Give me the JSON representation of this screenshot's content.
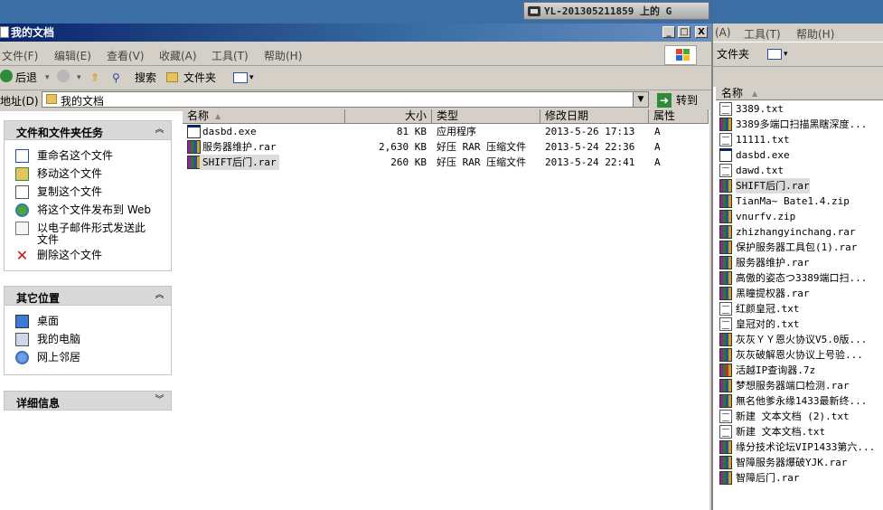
{
  "remote_title": "YL-201305211859 上的 G",
  "window": {
    "title": "我的文档",
    "controls": {
      "minimize": "_",
      "maximize": "□",
      "close": "X"
    }
  },
  "menu": [
    "文件(F)",
    "编辑(E)",
    "查看(V)",
    "收藏(A)",
    "工具(T)",
    "帮助(H)"
  ],
  "toolbar": {
    "back": "后退",
    "search": "搜索",
    "folders": "文件夹"
  },
  "address": {
    "label": "地址(D)",
    "value": "我的文档",
    "go": "转到"
  },
  "taskpane": {
    "tasks": {
      "title": "文件和文件夹任务",
      "items": [
        "重命名这个文件",
        "移动这个文件",
        "复制这个文件",
        "将这个文件发布到 Web",
        "以电子邮件形式发送此文件",
        "删除这个文件"
      ]
    },
    "places": {
      "title": "其它位置",
      "items": [
        "桌面",
        "我的电脑",
        "网上邻居"
      ]
    },
    "details": {
      "title": "详细信息"
    }
  },
  "columns": {
    "name": "名称",
    "size": "大小",
    "type": "类型",
    "modified": "修改日期",
    "attr": "属性"
  },
  "files": [
    {
      "icon": "exe-icon",
      "name": "dasbd.exe",
      "size": "81 KB",
      "type": "应用程序",
      "modified": "2013-5-26 17:13",
      "attr": "A"
    },
    {
      "icon": "rar-icon",
      "name": "服务器维护.rar",
      "size": "2,630 KB",
      "type": "好压 RAR 压缩文件",
      "modified": "2013-5-24 22:36",
      "attr": "A"
    },
    {
      "icon": "rar-icon",
      "name": "SHIFT后门.rar",
      "size": "260 KB",
      "type": "好压 RAR 压缩文件",
      "modified": "2013-5-24 22:41",
      "attr": "A"
    }
  ],
  "right_panel": {
    "menu": [
      "(A)",
      "工具(T)",
      "帮助(H)"
    ],
    "folders_label": "文件夹",
    "column": "名称",
    "items": [
      {
        "icon": "txt-icon",
        "name": "3389.txt"
      },
      {
        "icon": "rar-icon",
        "name": "3389多端口扫描黑瞎深度..."
      },
      {
        "icon": "txt-icon",
        "name": "11111.txt"
      },
      {
        "icon": "exe-icon",
        "name": "dasbd.exe"
      },
      {
        "icon": "txt-icon",
        "name": "dawd.txt"
      },
      {
        "icon": "rar-icon",
        "name": "SHIFT后门.rar"
      },
      {
        "icon": "zip-icon",
        "name": "TianMa~ Bate1.4.zip"
      },
      {
        "icon": "zip-icon",
        "name": "vnurfv.zip"
      },
      {
        "icon": "rar-icon",
        "name": "zhizhangyinchang.rar"
      },
      {
        "icon": "rar-icon",
        "name": "保护服务器工具包(1).rar"
      },
      {
        "icon": "rar-icon",
        "name": "服务器维护.rar"
      },
      {
        "icon": "rar-icon",
        "name": "高傲的姿态つ3389端口扫..."
      },
      {
        "icon": "rar-icon",
        "name": "黑瞳提权器.rar"
      },
      {
        "icon": "txt-icon",
        "name": "红颜皇冠.txt"
      },
      {
        "icon": "txt-icon",
        "name": "皇冠对的.txt"
      },
      {
        "icon": "rar-icon",
        "name": "灰灰ＹＹ恩火协议V5.0版..."
      },
      {
        "icon": "rar-icon",
        "name": "灰灰破解恩火协议上号验..."
      },
      {
        "icon": "7z-icon",
        "name": "活越IP查询器.7z"
      },
      {
        "icon": "rar-icon",
        "name": "梦想服务器端口检测.rar"
      },
      {
        "icon": "rar-icon",
        "name": "無名他爹永缘1433最新终..."
      },
      {
        "icon": "txt-icon",
        "name": "新建 文本文档 (2).txt"
      },
      {
        "icon": "txt-icon",
        "name": "新建 文本文档.txt"
      },
      {
        "icon": "rar-icon",
        "name": "缘分技术论坛VIP1433第六..."
      },
      {
        "icon": "rar-icon",
        "name": "智障服务器爆破YJK.rar"
      },
      {
        "icon": "rar-icon",
        "name": "智障后门.rar"
      }
    ]
  },
  "colors": {
    "titlebar": "#0a246a",
    "chrome": "#d4d0c8",
    "task_header": "#d8d8d8",
    "selection": "#dcdcdc",
    "go_arrow": "#2e8b3a"
  }
}
